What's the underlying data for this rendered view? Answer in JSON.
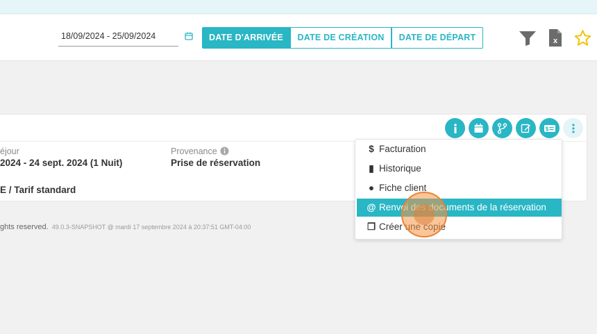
{
  "header": {
    "date_range": "18/09/2024 - 25/09/2024",
    "tabs": [
      {
        "label": "DATE D'ARRIVÉE",
        "active": true
      },
      {
        "label": "DATE DE CRÉATION",
        "active": false
      },
      {
        "label": "DATE DE DÉPART",
        "active": false
      }
    ]
  },
  "card": {
    "sejour_label": "éjour",
    "sejour_value": " 2024 - 24 sept. 2024 (1 Nuit)",
    "provenance_label": "Provenance",
    "provenance_value": "Prise de réservation",
    "tarif_value": "E / Tarif standard"
  },
  "footer": {
    "rights": "ghts reserved.",
    "version": "49.0.3-SNAPSHOT @ mardi 17 septembre 2024 à 20:37:51 GMT-04:00"
  },
  "menu": {
    "items": [
      {
        "icon": "dollar-icon",
        "glyph": "$",
        "label": "Facturation"
      },
      {
        "icon": "book-icon",
        "glyph": "▮",
        "label": "Historique"
      },
      {
        "icon": "user-icon",
        "glyph": "●",
        "label": "Fiche client"
      },
      {
        "icon": "at-icon",
        "glyph": "@",
        "label": "Renvoi des documents de la réservation"
      },
      {
        "icon": "copy-icon",
        "glyph": "❐",
        "label": "Créer une copie"
      }
    ],
    "active_index": 3
  },
  "colors": {
    "accent": "#29b6c5",
    "star": "#f2c200",
    "icon_gray": "#6b6b6b"
  }
}
